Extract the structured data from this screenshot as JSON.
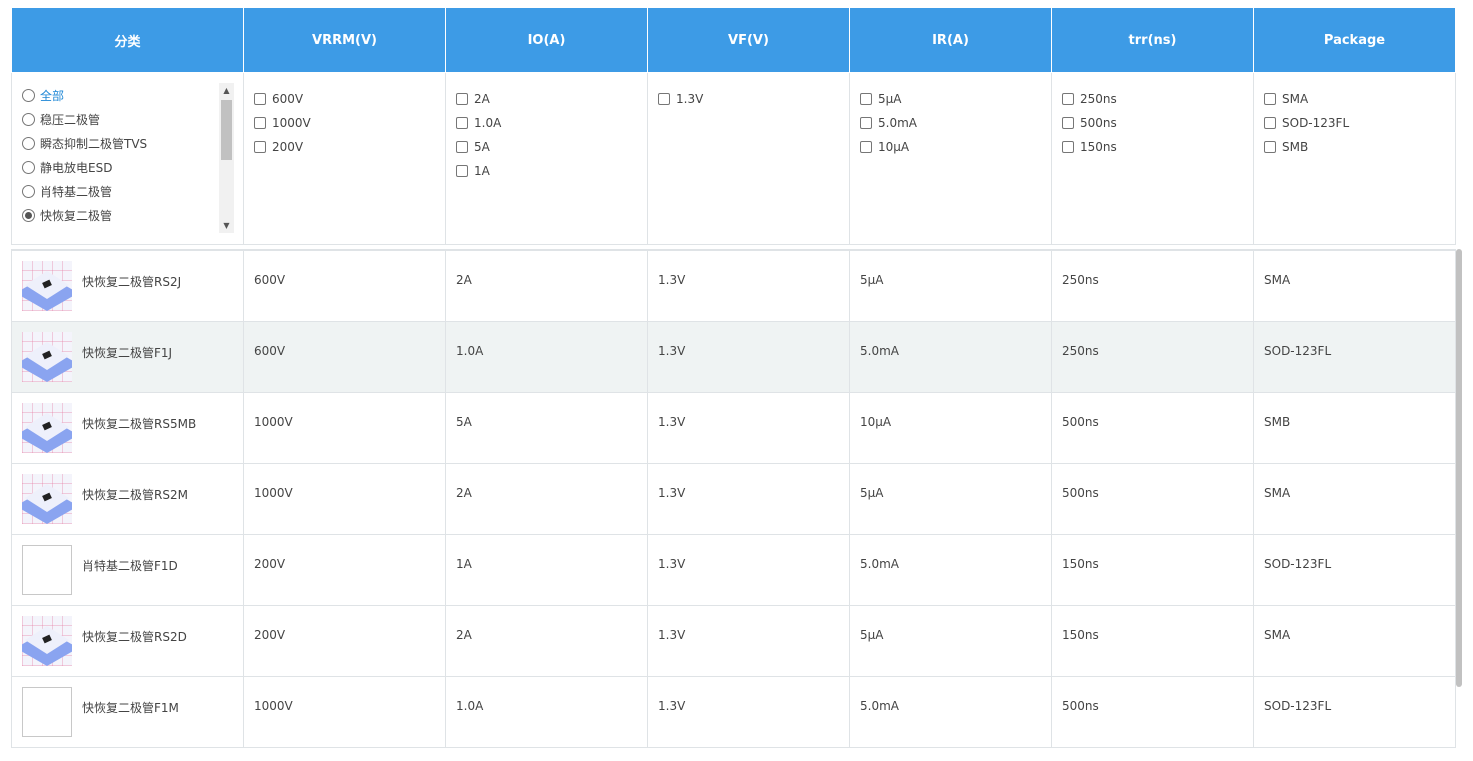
{
  "filters": {
    "headers": {
      "category": "分类",
      "vrrm": "VRRM(V)",
      "io": "IO(A)",
      "vf": "VF(V)",
      "ir": "IR(A)",
      "trr": "trr(ns)",
      "package": "Package"
    },
    "category_options": [
      {
        "label": "全部",
        "checked": false,
        "highlight": true
      },
      {
        "label": "稳压二极管",
        "checked": false
      },
      {
        "label": "瞬态抑制二极管TVS",
        "checked": false
      },
      {
        "label": "静电放电ESD",
        "checked": false
      },
      {
        "label": "肖特基二极管",
        "checked": false
      },
      {
        "label": "快恢复二极管",
        "checked": true
      }
    ],
    "vrrm_options": [
      "600V",
      "1000V",
      "200V"
    ],
    "io_options": [
      "2A",
      "1.0A",
      "5A",
      "1A"
    ],
    "vf_options": [
      "1.3V"
    ],
    "ir_options": [
      "5μA",
      "5.0mA",
      "10μA"
    ],
    "trr_options": [
      "250ns",
      "500ns",
      "150ns"
    ],
    "package_options": [
      "SMA",
      "SOD-123FL",
      "SMB"
    ]
  },
  "results": [
    {
      "name": "快恢复二极管RS2J",
      "image": "photo",
      "vrrm": "600V",
      "io": "2A",
      "vf": "1.3V",
      "ir": "5μA",
      "trr": "250ns",
      "package": "SMA"
    },
    {
      "name": "快恢复二极管F1J",
      "image": "photo",
      "vrrm": "600V",
      "io": "1.0A",
      "vf": "1.3V",
      "ir": "5.0mA",
      "trr": "250ns",
      "package": "SOD-123FL"
    },
    {
      "name": "快恢复二极管RS5MB",
      "image": "photo",
      "vrrm": "1000V",
      "io": "5A",
      "vf": "1.3V",
      "ir": "10μA",
      "trr": "500ns",
      "package": "SMB"
    },
    {
      "name": "快恢复二极管RS2M",
      "image": "photo",
      "vrrm": "1000V",
      "io": "2A",
      "vf": "1.3V",
      "ir": "5μA",
      "trr": "500ns",
      "package": "SMA"
    },
    {
      "name": "肖特基二极管F1D",
      "image": "blank",
      "vrrm": "200V",
      "io": "1A",
      "vf": "1.3V",
      "ir": "5.0mA",
      "trr": "150ns",
      "package": "SOD-123FL"
    },
    {
      "name": "快恢复二极管RS2D",
      "image": "photo",
      "vrrm": "200V",
      "io": "2A",
      "vf": "1.3V",
      "ir": "5μA",
      "trr": "150ns",
      "package": "SMA"
    },
    {
      "name": "快恢复二极管F1M",
      "image": "blank",
      "vrrm": "1000V",
      "io": "1.0A",
      "vf": "1.3V",
      "ir": "5.0mA",
      "trr": "500ns",
      "package": "SOD-123FL"
    }
  ],
  "highlighted_row": 1,
  "colors": {
    "header_bg": "#3d9be6",
    "row_highlight": "#eff3f3",
    "link": "#1e87d6"
  }
}
